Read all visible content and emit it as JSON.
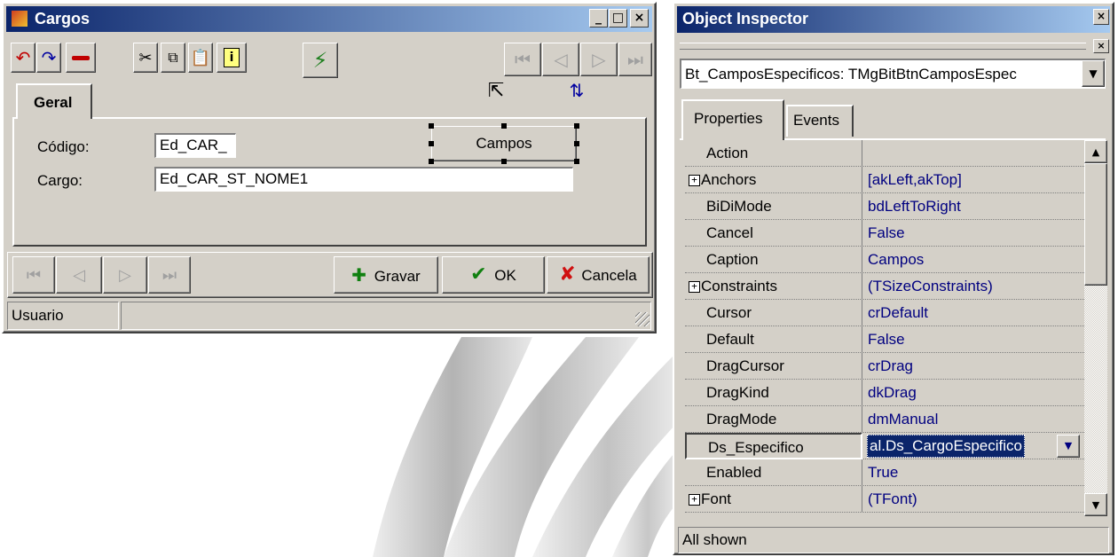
{
  "cargos": {
    "title": "Cargos",
    "window_buttons": [
      "_",
      "□",
      "×"
    ],
    "tab": "Geral",
    "fields": [
      {
        "label": "Código:",
        "value": "Ed_CAR_"
      },
      {
        "label": "Cargo:",
        "value": "Ed_CAR_ST_NOME1"
      }
    ],
    "campos_button": "Campos",
    "buttons": {
      "gravar": "Gravar",
      "ok": "OK",
      "cancela": "Cancela"
    },
    "status": "Usuario"
  },
  "inspector": {
    "title": "Object Inspector",
    "component": "Bt_CamposEspecificos: TMgBitBtnCamposEspec",
    "tabs": [
      "Properties",
      "Events"
    ],
    "properties": [
      {
        "name": "Action",
        "value": "",
        "expandable": false
      },
      {
        "name": "Anchors",
        "value": "[akLeft,akTop]",
        "expandable": true
      },
      {
        "name": "BiDiMode",
        "value": "bdLeftToRight",
        "expandable": false
      },
      {
        "name": "Cancel",
        "value": "False",
        "expandable": false
      },
      {
        "name": "Caption",
        "value": "Campos",
        "expandable": false
      },
      {
        "name": "Constraints",
        "value": "(TSizeConstraints)",
        "expandable": true
      },
      {
        "name": "Cursor",
        "value": "crDefault",
        "expandable": false
      },
      {
        "name": "Default",
        "value": "False",
        "expandable": false
      },
      {
        "name": "DragCursor",
        "value": "crDrag",
        "expandable": false
      },
      {
        "name": "DragKind",
        "value": "dkDrag",
        "expandable": false
      },
      {
        "name": "DragMode",
        "value": "dmManual",
        "expandable": false
      },
      {
        "name": "Ds_Especifico",
        "value": "al.Ds_CargoEspecifico",
        "expandable": false,
        "selected": true
      },
      {
        "name": "Enabled",
        "value": "True",
        "expandable": false
      },
      {
        "name": "Font",
        "value": "(TFont)",
        "expandable": true
      }
    ],
    "status": "All shown"
  }
}
